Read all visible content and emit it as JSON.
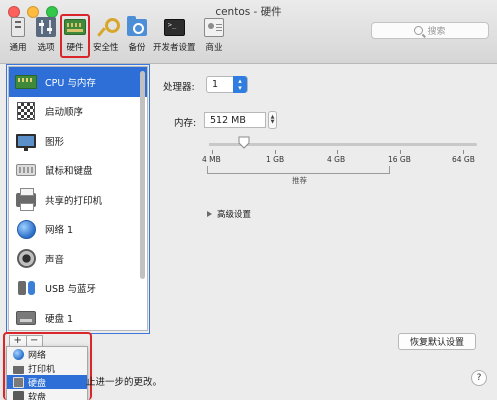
{
  "window": {
    "title": "centos - 硬件"
  },
  "search": {
    "placeholder": "搜索"
  },
  "toolbar": {
    "items": [
      {
        "label": "通用",
        "icon": "general-icon"
      },
      {
        "label": "选项",
        "icon": "options-icon"
      },
      {
        "label": "硬件",
        "icon": "hardware-icon",
        "selected": true
      },
      {
        "label": "安全性",
        "icon": "key-icon"
      },
      {
        "label": "备份",
        "icon": "backup-folder-icon"
      },
      {
        "label": "开发者设置",
        "icon": "terminal-icon"
      },
      {
        "label": "商业",
        "icon": "business-card-icon"
      }
    ]
  },
  "sidebar": {
    "items": [
      {
        "label": "CPU 与内存",
        "icon": "cpu-memory-icon",
        "selected": true
      },
      {
        "label": "启动顺序",
        "icon": "boot-order-icon"
      },
      {
        "label": "图形",
        "icon": "display-icon"
      },
      {
        "label": "鼠标和键盘",
        "icon": "keyboard-icon"
      },
      {
        "label": "共享的打印机",
        "icon": "printer-icon"
      },
      {
        "label": "网络 1",
        "icon": "network-globe-icon"
      },
      {
        "label": "声音",
        "icon": "speaker-icon"
      },
      {
        "label": "USB 与蓝牙",
        "icon": "usb-bluetooth-icon"
      },
      {
        "label": "硬盘 1",
        "icon": "hard-disk-icon"
      }
    ],
    "add_label": "+",
    "remove_label": "−"
  },
  "add_menu": {
    "items": [
      {
        "label": "网络",
        "icon": "network-globe-icon"
      },
      {
        "label": "打印机",
        "icon": "printer-icon"
      },
      {
        "label": "硬盘",
        "icon": "hard-disk-icon",
        "selected": true
      },
      {
        "label": "软盘",
        "icon": "floppy-icon"
      }
    ]
  },
  "cpu": {
    "label": "处理器:",
    "value": "1"
  },
  "memory": {
    "label": "内存:",
    "value": "512 MB",
    "ticks": [
      "4 MB",
      "1 GB",
      "4 GB",
      "16 GB",
      "64 GB"
    ],
    "recommended_label": "推荐",
    "slider_fraction": 0.13
  },
  "advanced": {
    "label": "高级设置"
  },
  "restore_button": {
    "label": "恢复默认设置"
  },
  "footer": {
    "text": "止进一步的更改。"
  },
  "help": {
    "label": "?"
  },
  "colors": {
    "accent": "#2d6fd6",
    "highlight_box": "#d9262a"
  }
}
